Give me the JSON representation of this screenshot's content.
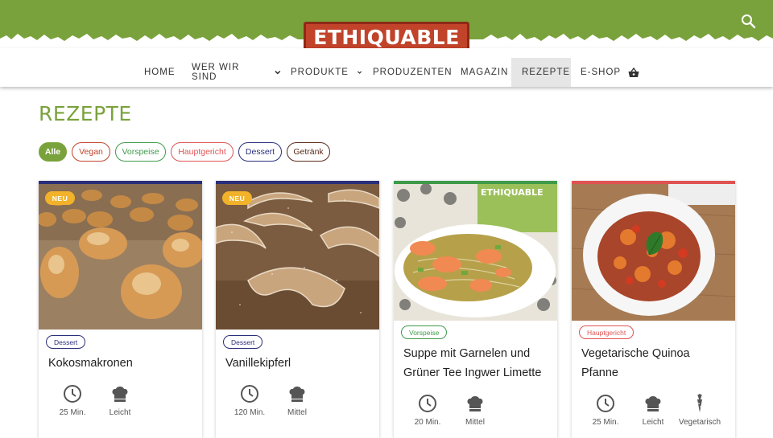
{
  "brand": {
    "logo_text": "ETHIQUABLE",
    "green": "#7aa23c",
    "red": "#c0432a"
  },
  "header": {
    "search_icon": "search-icon"
  },
  "nav": {
    "items": [
      {
        "label": "HOME"
      },
      {
        "label": "WER WIR SIND",
        "dropdown": true
      },
      {
        "label": "PRODUKTE",
        "dropdown": true
      },
      {
        "label": "PRODUZENTEN"
      },
      {
        "label": "MAGAZIN"
      },
      {
        "label": "REZEPTE",
        "active": true
      },
      {
        "label": "E-SHOP",
        "icon": "basket-icon"
      }
    ]
  },
  "page": {
    "title": "REZEPTE"
  },
  "filters": [
    {
      "label": "Alle",
      "color": "#7aa23c",
      "active": true
    },
    {
      "label": "Vegan",
      "color": "#c0432a"
    },
    {
      "label": "Vorspeise",
      "color": "#3f9a4a"
    },
    {
      "label": "Hauptgericht",
      "color": "#e05353"
    },
    {
      "label": "Dessert",
      "color": "#2a2f7a"
    },
    {
      "label": "Getränk",
      "color": "#5a2a1a"
    }
  ],
  "cards": [
    {
      "badge": "NEU",
      "category": "Dessert",
      "category_color": "#2a2f7a",
      "title_line1": "Kokosmakronen",
      "title_line2": "",
      "time": "25 Min.",
      "difficulty": "Leicht"
    },
    {
      "badge": "NEU",
      "category": "Dessert",
      "category_color": "#2a2f7a",
      "title_line1": "Vanillekipferl",
      "title_line2": "",
      "time": "120 Min.",
      "difficulty": "Mittel"
    },
    {
      "category": "Vorspeise",
      "category_color": "#3f9a4a",
      "title_line1": "Suppe mit Garnelen und",
      "title_line2": "Grüner Tee Ingwer Limette",
      "time": "20 Min.",
      "difficulty": "Mittel",
      "package_text": "ETHIQUABLE"
    },
    {
      "category": "Hauptgericht",
      "category_color": "#e05353",
      "title_line1": "Vegetarische Quinoa",
      "title_line2": "Pfanne",
      "time": "25 Min.",
      "difficulty": "Leicht",
      "diet": "Vegetarisch"
    }
  ]
}
